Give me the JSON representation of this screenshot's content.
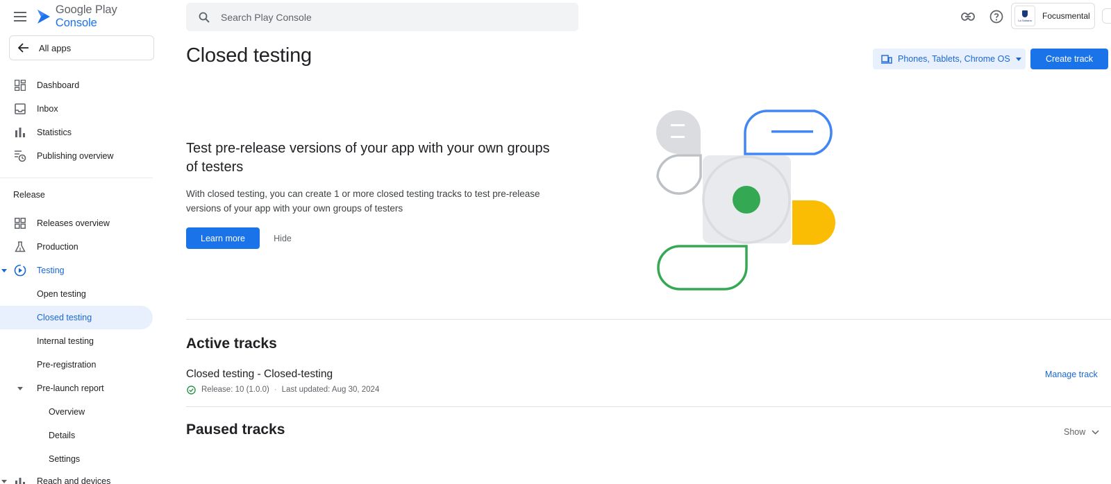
{
  "brand": {
    "text_gray": "Google Play",
    "text_blue": "Console"
  },
  "all_apps_label": "All apps",
  "sidebar": {
    "items": [
      {
        "label": "Dashboard",
        "icon": "dashboard-icon"
      },
      {
        "label": "Inbox",
        "icon": "inbox-icon"
      },
      {
        "label": "Statistics",
        "icon": "bar-chart-icon"
      },
      {
        "label": "Publishing overview",
        "icon": "publishing-overview-icon"
      }
    ],
    "release_section": "Release",
    "release_items": [
      {
        "label": "Releases overview",
        "icon": "releases-overview-icon"
      },
      {
        "label": "Production",
        "icon": "flask-icon"
      },
      {
        "label": "Testing",
        "icon": "testing-icon"
      },
      {
        "label": "Open testing"
      },
      {
        "label": "Closed testing"
      },
      {
        "label": "Internal testing"
      },
      {
        "label": "Pre-registration"
      },
      {
        "label": "Pre-launch report"
      },
      {
        "label": "Overview"
      },
      {
        "label": "Details"
      },
      {
        "label": "Settings"
      },
      {
        "label": "Reach and devices",
        "icon": "reach-devices-icon"
      }
    ]
  },
  "search": {
    "placeholder": "Search Play Console"
  },
  "account": {
    "name": "Focusmental",
    "avatar_text": "La Sabana"
  },
  "page": {
    "title": "Closed testing",
    "device_filter": "Phones, Tablets, Chrome OS",
    "create_track_label": "Create track"
  },
  "promo": {
    "title": "Test pre-release versions of your app with your own groups of testers",
    "text": "With closed testing, you can create 1 or more closed testing tracks to test pre-release versions of your app with your own groups of testers",
    "learn_more_label": "Learn more",
    "hide_label": "Hide"
  },
  "active_tracks": {
    "title": "Active tracks",
    "tracks": [
      {
        "name": "Closed testing - Closed-testing",
        "release": "Release: 10 (1.0.0)",
        "updated": "Last updated: Aug 30, 2024",
        "action": "Manage track"
      }
    ]
  },
  "paused_tracks": {
    "title": "Paused tracks",
    "toggle_label": "Show"
  },
  "colors": {
    "accent": "#1a73e8",
    "active_bg": "#e8f0fe",
    "green": "#34a853",
    "yellow": "#fbbc04",
    "blue_outline": "#4285f4"
  }
}
